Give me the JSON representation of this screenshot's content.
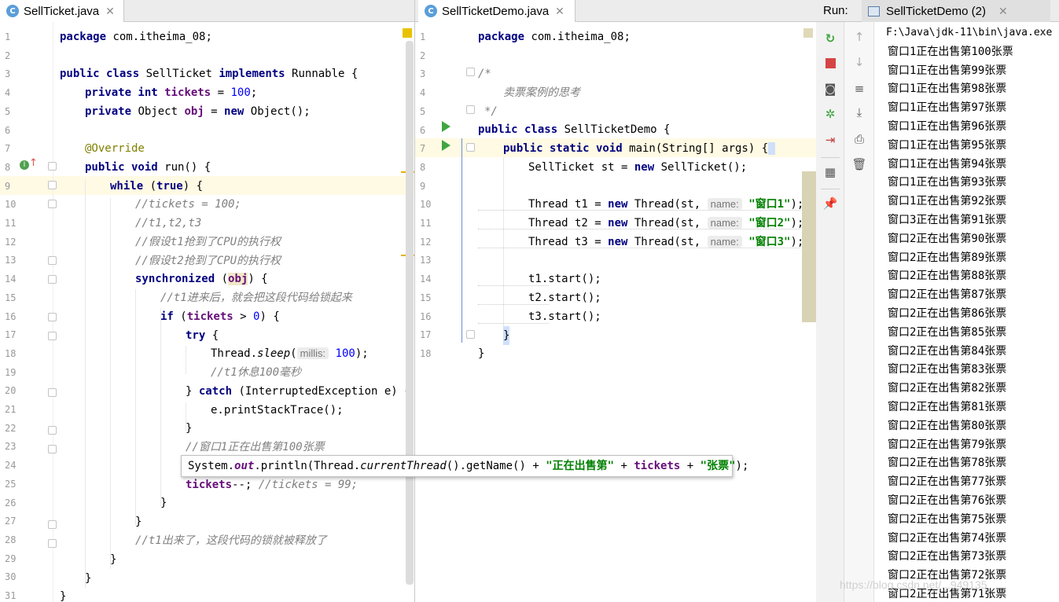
{
  "tabs": {
    "left": {
      "label": "SellTicket.java",
      "icon": "C"
    },
    "middle": {
      "label": "SellTicketDemo.java",
      "icon": "C"
    }
  },
  "run": {
    "label": "Run:",
    "tab": "SellTicketDemo (2)"
  },
  "popup_text": "",
  "console_lines": [
    "F:\\Java\\jdk-11\\bin\\java.exe",
    "窗口1正在出售第100张票",
    "窗口1正在出售第99张票",
    "窗口1正在出售第98张票",
    "窗口1正在出售第97张票",
    "窗口1正在出售第96张票",
    "窗口1正在出售第95张票",
    "窗口1正在出售第94张票",
    "窗口1正在出售第93张票",
    "窗口1正在出售第92张票",
    "窗口3正在出售第91张票",
    "窗口2正在出售第90张票",
    "窗口2正在出售第89张票",
    "窗口2正在出售第88张票",
    "窗口2正在出售第87张票",
    "窗口2正在出售第86张票",
    "窗口2正在出售第85张票",
    "窗口2正在出售第84张票",
    "窗口2正在出售第83张票",
    "窗口2正在出售第82张票",
    "窗口2正在出售第81张票",
    "窗口2正在出售第80张票",
    "窗口2正在出售第79张票",
    "窗口2正在出售第78张票",
    "窗口2正在出售第77张票",
    "窗口2正在出售第76张票",
    "窗口2正在出售第75张票",
    "窗口2正在出售第74张票",
    "窗口2正在出售第73张票",
    "窗口2正在出售第72张票",
    "窗口2正在出售第71张票"
  ],
  "watermark": "https://blog.csdn.net/...949135",
  "left_line_numbers": [
    "1",
    "2",
    "3",
    "4",
    "5",
    "6",
    "7",
    "8",
    "9",
    "10",
    "11",
    "12",
    "13",
    "14",
    "15",
    "16",
    "17",
    "18",
    "19",
    "20",
    "21",
    "22",
    "23",
    "24",
    "25",
    "26",
    "27",
    "28",
    "29",
    "30",
    "31"
  ],
  "middle_line_numbers": [
    "1",
    "2",
    "3",
    "4",
    "5",
    "6",
    "7",
    "8",
    "9",
    "10",
    "11",
    "12",
    "13",
    "14",
    "15",
    "16",
    "17",
    "18"
  ],
  "left_code": {
    "l1": [
      "package",
      " com.itheima_08;"
    ],
    "l3": [
      "public class",
      " SellTicket ",
      "implements",
      " Runnable {"
    ],
    "l4": [
      "private int",
      " ",
      "tickets",
      " = ",
      "100",
      ";"
    ],
    "l5": [
      "private",
      " Object ",
      "obj",
      " = ",
      "new",
      " Object();"
    ],
    "l7": "@Override",
    "l8": [
      "public void",
      " run() {"
    ],
    "l9": [
      "while",
      " (",
      "true",
      ") {"
    ],
    "l10": "//tickets = 100;",
    "l11": "//t1,t2,t3",
    "l12": "//假设t1抢到了CPU的执行权",
    "l13": "//假设t2抢到了CPU的执行权",
    "l14": [
      "synchronized",
      " (",
      "obj",
      ") {"
    ],
    "l15": "//t1进来后，就会把这段代码给锁起来",
    "l16": [
      "if",
      " (",
      "tickets",
      " > ",
      "0",
      ") {"
    ],
    "l17": [
      "try",
      " {"
    ],
    "l18": [
      "Thread.",
      "sleep",
      "(",
      "millis:",
      " ",
      "100",
      ");"
    ],
    "l19": "//t1休息100毫秒",
    "l20": [
      "} ",
      "catch",
      " (InterruptedException e) {"
    ],
    "l21": "e.printStackTrace();",
    "l22": "}",
    "l23": "//窗口1正在出售第100张票",
    "l25": [
      "tickets",
      "--; ",
      "//tickets = 99;"
    ],
    "l26": "}",
    "l27": "}",
    "l28": "//t1出来了，这段代码的锁就被释放了",
    "l29": "}",
    "l30": "}",
    "l31": "}"
  },
  "popup": [
    "System.",
    "out",
    ".println(Thread.",
    "currentThread",
    "().getName() + ",
    "\"正在出售第\"",
    " + ",
    "tickets",
    " + ",
    "\"张票\"",
    ");"
  ],
  "middle_code": {
    "l1": [
      "package",
      " com.itheima_08;"
    ],
    "l3": "/*",
    "l4": "卖票案例的思考",
    "l5": "*/",
    "l6": [
      "public class",
      " SellTicketDemo {"
    ],
    "l7": [
      "public static void",
      " main(String[] args) {"
    ],
    "l8": [
      "SellTicket st = ",
      "new",
      " SellTicket();"
    ],
    "l10": [
      "Thread t1 = ",
      "new",
      " Thread(st, ",
      "name:",
      " ",
      "\"窗口1\"",
      ");"
    ],
    "l11": [
      "Thread t2 = ",
      "new",
      " Thread(st, ",
      "name:",
      " ",
      "\"窗口2\"",
      ");"
    ],
    "l12": [
      "Thread t3 = ",
      "new",
      " Thread(st, ",
      "name:",
      " ",
      "\"窗口3\"",
      ");"
    ],
    "l14": "t1.start();",
    "l15": "t2.start();",
    "l16": "t3.start();",
    "l17": "}",
    "l18": "}"
  }
}
